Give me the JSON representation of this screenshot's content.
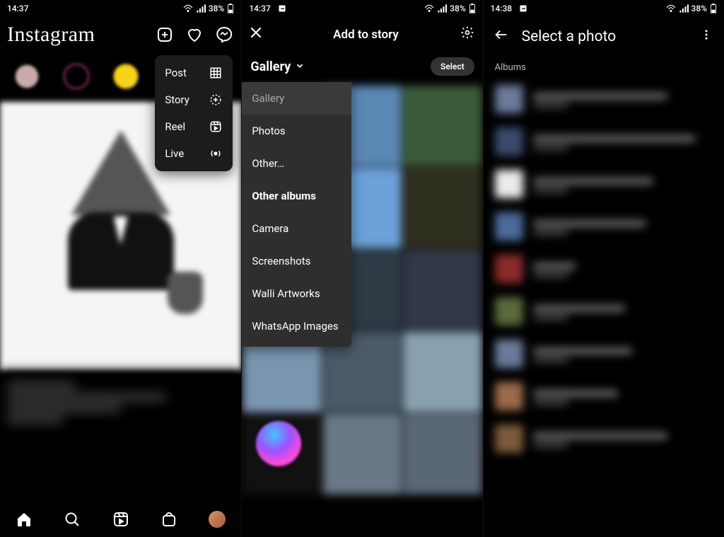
{
  "status": {
    "time1": "14:37",
    "time2": "14:37",
    "time3": "14:38",
    "battery": "38%"
  },
  "screen1": {
    "logo": "Instagram",
    "menu": {
      "post": "Post",
      "story": "Story",
      "reel": "Reel",
      "live": "Live"
    }
  },
  "screen2": {
    "title": "Add to story",
    "gallery_label": "Gallery",
    "select": "Select",
    "dropdown": {
      "gallery": "Gallery",
      "photos": "Photos",
      "other": "Other…",
      "other_albums": "Other albums",
      "camera": "Camera",
      "screenshots": "Screenshots",
      "walli": "Walli Artworks",
      "whatsapp": "WhatsApp Images"
    }
  },
  "screen3": {
    "title": "Select a photo",
    "albums": "Albums"
  }
}
